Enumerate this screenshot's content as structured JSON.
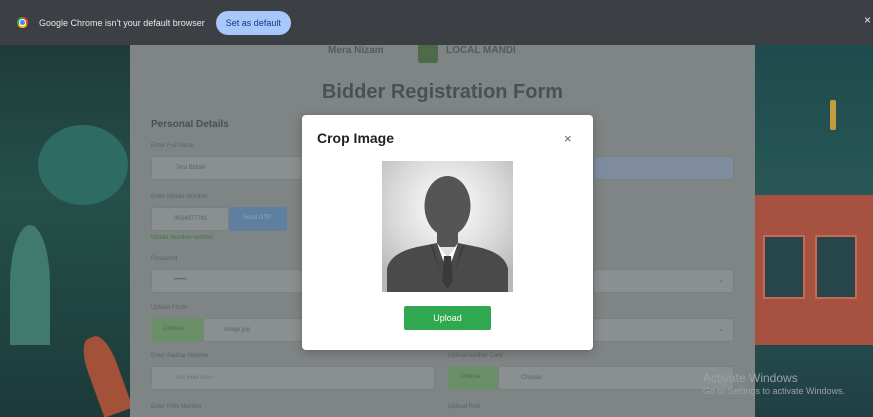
{
  "infobar": {
    "message": "Google Chrome isn't your default browser",
    "set_default_label": "Set as default",
    "close_glyph": "×"
  },
  "background_form": {
    "logo_left": "Mera Nizam",
    "logo_right": "LOCAL MANDI",
    "title": "Bidder Registration Form",
    "personal_details": "Personal Details",
    "full_name_label": "Enter Full Name",
    "full_name_value": "Test Bidder",
    "mobile_label": "Enter Mobile Number",
    "mobile_value": "9634977761",
    "send_otp": "Send OTP",
    "verified": "Mobile Number verified",
    "password_label": "Password",
    "password_value": "••••••",
    "upload_photo_label": "Upload Photo",
    "choose_label": "Choose",
    "photo_file": "image.jpg",
    "aadhar_label": "Enter Aadhar Number",
    "aadhar_value": "xxx xxxx xxxx",
    "upload_aadhar_label": "Upload Aadhar Card",
    "aadhar_choose": "Choose",
    "aadhar_file": "Choose",
    "pan_label": "Enter PAN Number",
    "upload_pan_label": "Upload PAN"
  },
  "watermark": {
    "line1": "Activate Windows",
    "line2": "Go to Settings to activate Windows."
  },
  "modal": {
    "title": "Crop Image",
    "close_glyph": "×",
    "upload_label": "Upload"
  },
  "colors": {
    "upload_green": "#2fa84f",
    "infobar_bg": "#3c3f43",
    "set_default_bg": "#a8c7fa"
  }
}
